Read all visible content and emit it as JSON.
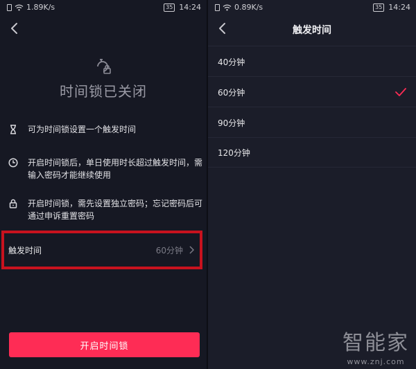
{
  "left_screen": {
    "status": {
      "speed": "1.89K/s",
      "battery": "35",
      "time": "14:24"
    },
    "title": "时间锁已关闭",
    "info": [
      {
        "icon": "hourglass-icon",
        "text": "可为时间锁设置一个触发时间"
      },
      {
        "icon": "clock-icon",
        "text": "开启时间锁后，单日使用时长超过触发时间，需输入密码才能继续使用"
      },
      {
        "icon": "lock-icon",
        "text": "开启时间锁，需先设置独立密码；忘记密码后可通过申诉重置密码"
      }
    ],
    "trigger": {
      "label": "触发时间",
      "value": "60分钟"
    },
    "button_label": "开启时间锁",
    "colors": {
      "accent": "#fe2c55",
      "highlight_border": "#c8121e",
      "background": "#161823"
    }
  },
  "right_screen": {
    "status": {
      "speed": "0.89K/s",
      "battery": "35",
      "time": "14:24"
    },
    "title": "触发时间",
    "options": [
      {
        "label": "40分钟",
        "selected": false
      },
      {
        "label": "60分钟",
        "selected": true
      },
      {
        "label": "90分钟",
        "selected": false
      },
      {
        "label": "120分钟",
        "selected": false
      }
    ],
    "colors": {
      "check": "#fe2c55",
      "background": "#1b1d29"
    }
  },
  "watermark": {
    "brand": "智能家",
    "url": "www.znj.com"
  }
}
